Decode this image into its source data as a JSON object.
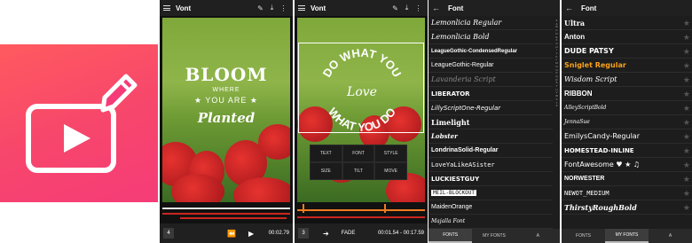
{
  "colors": {
    "icon_gradient_top": "#ff5a5f",
    "icon_gradient_bottom": "#f53c78",
    "timeline_red": "#c9261f",
    "handle_orange": "#f07c21",
    "gold_font": "#f7a21a"
  },
  "icons": {
    "app_icon": "video-edit-pencil-icon",
    "menu": "hamburger-icon",
    "edit": "pencil-icon",
    "export": "download-icon",
    "more": "more-vert-icon",
    "back": "arrow-back-icon",
    "rewind": "rewind-icon",
    "play": "play-icon",
    "forward": "arrow-forward-icon",
    "star": "star-icon"
  },
  "editor1": {
    "app_title": "Vont",
    "text_line1": "BLOOM",
    "text_line2": "WHERE",
    "text_line3": "★ YOU ARE ★",
    "text_line4": "Planted",
    "counter": "4",
    "time": "00:02.79"
  },
  "editor2": {
    "app_title": "Vont",
    "arc_text_top": "DO WHAT YOU",
    "arc_center": "Love",
    "arc_text_bottom": "WHAT YOU DO",
    "menu": [
      "TEXT",
      "FONT",
      "STYLE",
      "SIZE",
      "TILT",
      "MOVE"
    ],
    "counter": "3",
    "fade_label": "FADE",
    "time": "00:01.54 - 00:17.59"
  },
  "fontlist1": {
    "title": "Font",
    "fonts": [
      "Lemonlicia Regular",
      "Lemonlicia Bold",
      "LeagueGothic-CondensedRegular",
      "LeagueGothic-Regular",
      "Lavanderia Script",
      "LIBERATOR",
      "LillyScriptOne-Regular",
      "Limelight",
      "Lobster",
      "LondrinaSolid-Regular",
      "LoveYaLikeASister",
      "LUCKIESTGUY",
      "MEIL-BLOCKOUT",
      "MaidenOrange",
      "Majalla Font"
    ],
    "alpha": "#\nA\nB\nC\nD\nE\nF\nG\nH\nI\nJ\nK\nL\nM\nN\nO\nP\nQ\nR\nS\nT\nU\nV\nW\nX\nY\nZ",
    "tabs": [
      "FONTS",
      "MY FONTS",
      "A"
    ]
  },
  "fontlist2": {
    "title": "Font",
    "fonts": [
      "Ultra",
      "Anton",
      "DUDE PATSY",
      "Sniglet Regular",
      "Wisdom Script",
      "RIBBON",
      "AlleyScriptBold",
      "JennaSue",
      "EmilysCandy-Regular",
      "HOMESTEAD-INLINE",
      "FontAwesome ♥ ★ ♫",
      "NORWESTER",
      "NEWOT_MEDIUM",
      "ThirstyRoughBold"
    ],
    "tabs": [
      "FONTS",
      "MY FONTS",
      "A"
    ]
  }
}
